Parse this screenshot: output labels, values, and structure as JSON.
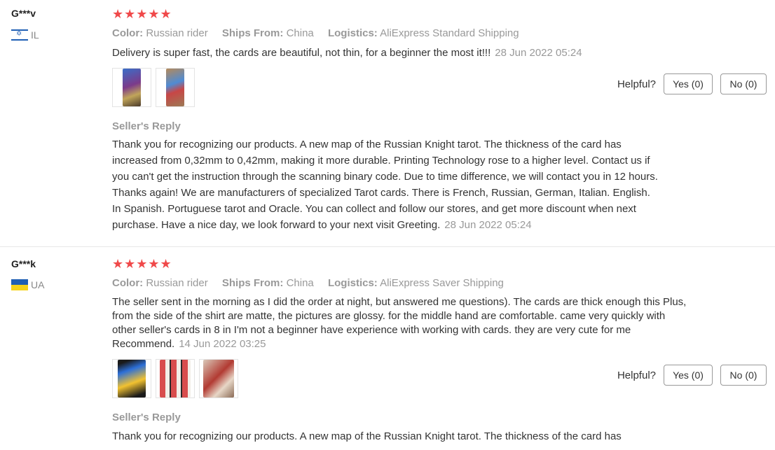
{
  "reviews": [
    {
      "user": "G***v",
      "country_code": "IL",
      "stars": "★★★★★",
      "meta": {
        "color_label": "Color:",
        "color_value": "Russian rider",
        "ships_label": "Ships From:",
        "ships_value": "China",
        "logistics_label": "Logistics:",
        "logistics_value": "AliExpress Standard Shipping"
      },
      "text": "Delivery is super fast, the cards are beautiful, not thin, for a beginner the most it!!!",
      "date": "28 Jun 2022 05:24",
      "helpful_label": "Helpful?",
      "yes_label": "Yes (0)",
      "no_label": "No (0)",
      "reply_title": "Seller's Reply",
      "reply_text": "Thank you for recognizing our products. A new map of the Russian Knight tarot. The thickness of the card has increased from 0,32mm to 0,42mm, making it more durable. Printing Technology rose to a higher level. Contact us if you can't get the instruction through the scanning binary code. Due to time difference, we will contact you in 12 hours. Thanks again! We are manufacturers of specialized Tarot cards. There is French, Russian, German, Italian. English. In Spanish. Portuguese tarot and Oracle. You can collect and follow our stores, and get more discount when next purchase. Have a nice day, we look forward to your next visit Greeting.",
      "reply_date": "28 Jun 2022 05:24"
    },
    {
      "user": "G***k",
      "country_code": "UA",
      "stars": "★★★★★",
      "meta": {
        "color_label": "Color:",
        "color_value": "Russian rider",
        "ships_label": "Ships From:",
        "ships_value": "China",
        "logistics_label": "Logistics:",
        "logistics_value": "AliExpress Saver Shipping"
      },
      "text": "The seller sent in the morning as I did the order at night, but answered me questions). The cards are thick enough this Plus, from the side of the shirt are matte, the pictures are glossy. for the middle hand are comfortable. came very quickly with other seller's cards in 8 in I'm not a beginner have experience with working with cards. they are very cute for me Recommend.",
      "date": "14 Jun 2022 03:25",
      "helpful_label": "Helpful?",
      "yes_label": "Yes (0)",
      "no_label": "No (0)",
      "reply_title": "Seller's Reply",
      "reply_text": "Thank you for recognizing our products. A new map of the Russian Knight tarot. The thickness of the card has"
    }
  ],
  "colors": {
    "star": "#f0494a",
    "muted": "#999999",
    "text": "#333333"
  }
}
